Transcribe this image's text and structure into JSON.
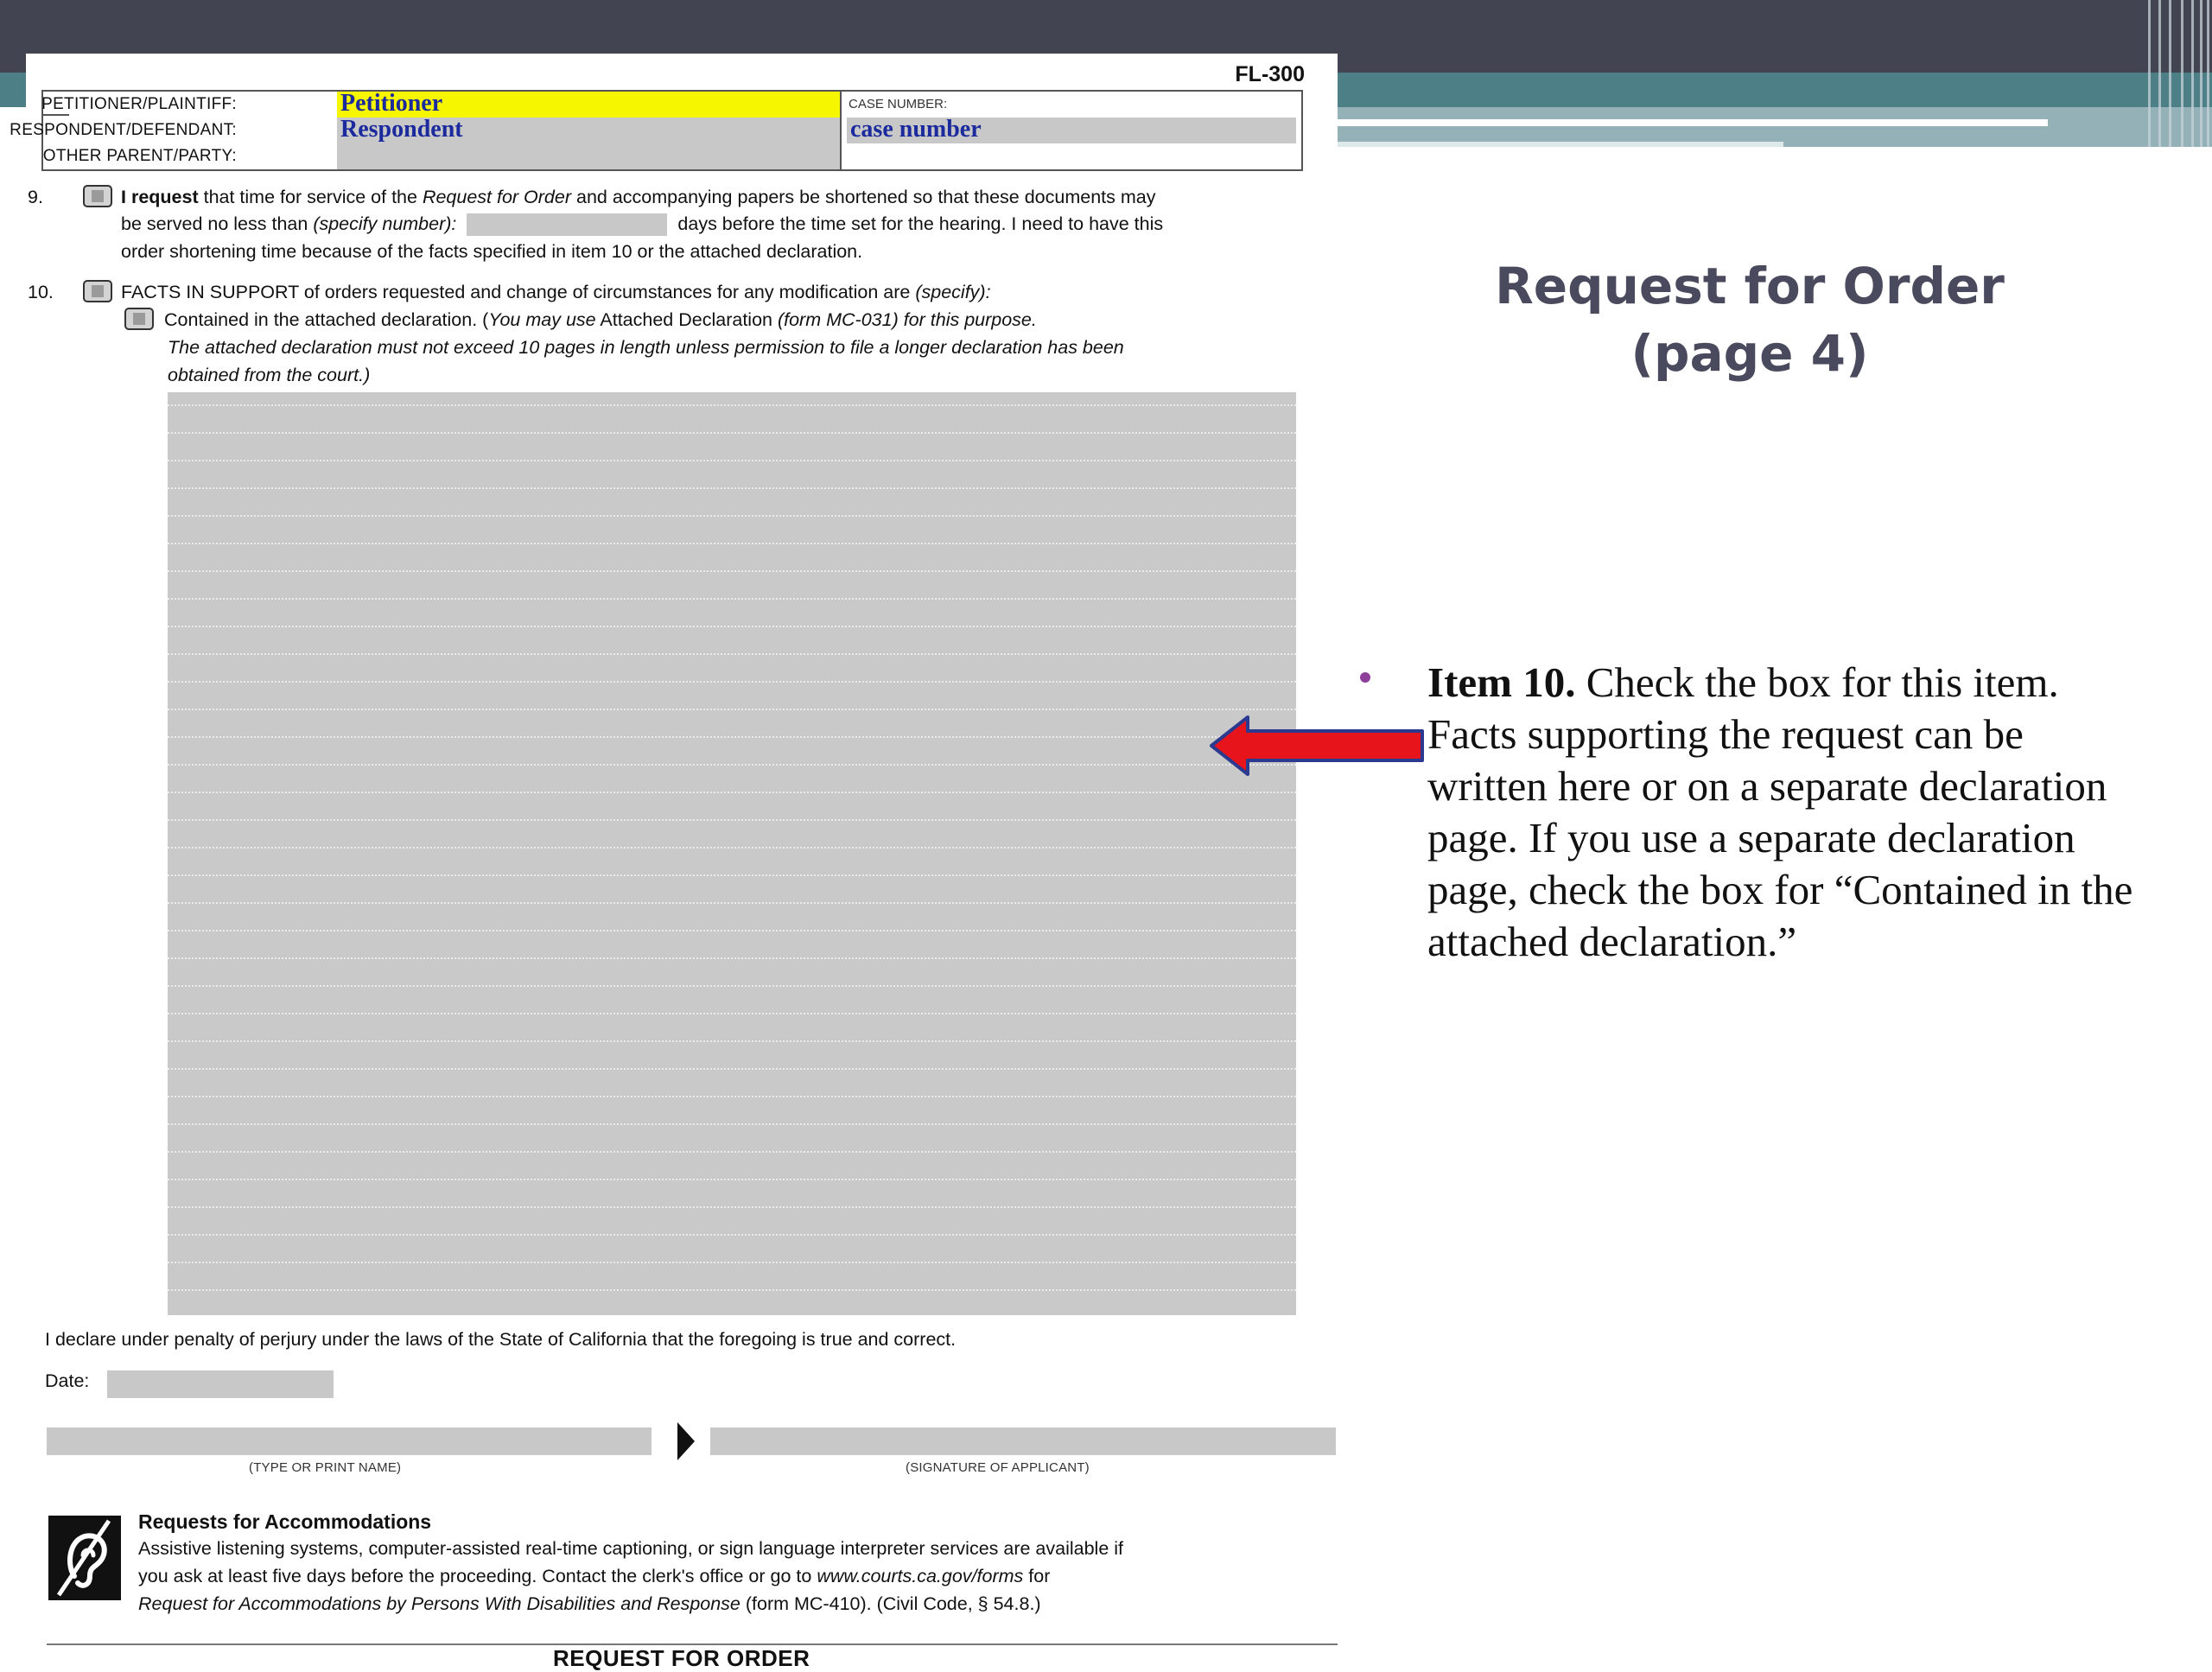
{
  "doc": {
    "form_id": "FL-300",
    "caption": {
      "petitioner_label": "PETITIONER/PLAINTIFF:",
      "petitioner_value": "Petitioner",
      "respondent_label": "RESPONDENT/DEFENDANT:",
      "respondent_value": "Respondent",
      "other_label": "OTHER PARENT/PARTY:",
      "case_number_label": "CASE NUMBER:",
      "case_number_value": "case number"
    },
    "item9": {
      "number": "9.",
      "bold": "I request",
      "l1a": " that time for service of the ",
      "l1b": "Request for Order",
      "l1c": " and accompanying papers be shortened so that these documents may",
      "l2a": "be served no less than ",
      "l2b": "(specify number):",
      "l2c": "days before the time set for the hearing. I need to have this",
      "l3": "order shortening time because of the facts specified in item 10 or the attached declaration."
    },
    "item10": {
      "number": "10.",
      "l1a": "FACTS IN SUPPORT of orders requested and change of circumstances for any modification are ",
      "l1b": "(specify):",
      "l2a": "Contained in the attached declaration. (",
      "l2b": "You may use",
      "l2c": " Attached Declaration ",
      "l2d": "(form MC-031) for this purpose.",
      "l3": "The attached declaration must not exceed 10 pages in length unless permission to file a longer declaration has been",
      "l4": "obtained from the court.)"
    },
    "declaration": "I declare under penalty of perjury under the laws of the State of California that the foregoing is true and correct.",
    "date_label": "Date:",
    "name_caption": "(TYPE OR PRINT NAME)",
    "signature_caption": "(SIGNATURE OF APPLICANT)",
    "accommodations": {
      "title": "Requests for Accommodations",
      "l1": "Assistive listening systems, computer-assisted real-time captioning, or sign language interpreter services are available if",
      "l2a": "you ask at least five days before the proceeding. Contact the clerk's office or go to ",
      "l2b": "www.courts.ca.gov/forms",
      "l2c": " for",
      "l3a": "Request for Accommodations by Persons With Disabilities and Response",
      "l3b": " (form MC-410). (Civil Code, § 54.8.)"
    },
    "footer_title": "REQUEST FOR ORDER"
  },
  "slide": {
    "title_line1": "Request for Order",
    "title_line2": "(page 4)",
    "bullet_bold": "Item 10.",
    "bullet_text": "  Check the box for this item.  Facts supporting the request can be written here or on a separate declaration page.  If you use a separate declaration page, check the box for “Contained in the attached declaration.”"
  },
  "colors": {
    "title": "#4a4a5e",
    "arrow_fill": "#e8141b",
    "arrow_stroke": "#2b3a8f",
    "bullet": "#8e3f9a",
    "field_gray": "#c8c8c8",
    "highlight_yellow": "#f6f600"
  },
  "icons": [
    "hearing-assistance-icon",
    "arrow-left-icon",
    "signature-pointer-icon"
  ]
}
